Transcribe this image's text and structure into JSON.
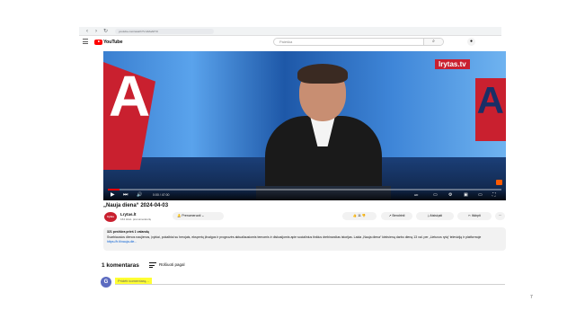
{
  "browser": {
    "url": "youtube.com/watch?v=sMuA0Y0",
    "back_icon": "arrow-left",
    "forward_icon": "arrow-right",
    "reload_icon": "reload"
  },
  "header": {
    "logo_text": "YouTube",
    "search_placeholder": "Paieška",
    "search_icon": "⌕",
    "mic_icon": "●"
  },
  "video": {
    "channel_watermark": "lrytas.tv",
    "big_letter": "A",
    "right_letter": "A",
    "time": "0:00 / 47:00",
    "progress": 0.03
  },
  "player_controls": {
    "play_icon": "▶",
    "next_icon": "⏭",
    "volume_icon": "🔊",
    "hd_label": "HD"
  },
  "meta": {
    "title": "„Nauja diena“ 2024-04-03",
    "channel_name": "Lrytas.lt",
    "channel_avatar_text": "lrytas",
    "subscriber_count": "164 tūkst. prenumeratorių",
    "subscribe_label": "Prenumeruoti",
    "subscribe_chevron": "⌄"
  },
  "actions": {
    "like_label": "11",
    "share_label": "Bendrinti",
    "download_label": "Atsisiųsti",
    "clip_label": "Iškirpti",
    "more_label": "···"
  },
  "description": {
    "stats": "321 peržiūra  prieš 1 valandą",
    "body": "Svarbiausios dienos naujienos, įvykiai, pokalbiai su herojais, ekspertų įžvalgos ir prognozės aktualiausiomis temomis ir diskusijomis apie socialinius tinklus drebinančias istorijas. Laida „Nauja diena“ kiekvieną darbo dieną 13 val. per „Lietuvos rytą“ televiziją ir platformoje",
    "link": "https://lr.lt/nauja-die..."
  },
  "comments": {
    "count_label": "1 komentaras",
    "sort_label": "Rūšiuoti pagal",
    "user_initial": "G",
    "input_placeholder": "Pridėti komentarą..."
  },
  "slide": {
    "page_number": "7"
  },
  "colors": {
    "brand_red": "#ff0000",
    "highlight": "#ffff33",
    "link": "#065fd4"
  }
}
